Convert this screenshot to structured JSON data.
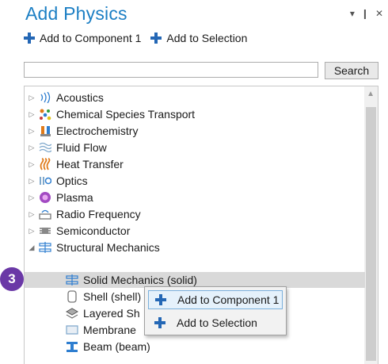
{
  "panel": {
    "title": "Add Physics",
    "controls": {
      "dropdown": "▾",
      "pin": "❙",
      "close": "✕"
    }
  },
  "toolbar": {
    "add_to_component": "Add to Component 1",
    "add_to_selection": "Add to Selection"
  },
  "search": {
    "value": "",
    "placeholder": "",
    "button_label": "Search"
  },
  "tree": {
    "items": [
      {
        "label": "Acoustics",
        "icon": "acoustics-icon",
        "expanded": false
      },
      {
        "label": "Chemical Species Transport",
        "icon": "chemical-species-icon",
        "expanded": false
      },
      {
        "label": "Electrochemistry",
        "icon": "electrochemistry-icon",
        "expanded": false
      },
      {
        "label": "Fluid Flow",
        "icon": "fluid-flow-icon",
        "expanded": false
      },
      {
        "label": "Heat Transfer",
        "icon": "heat-transfer-icon",
        "expanded": false
      },
      {
        "label": "Optics",
        "icon": "optics-icon",
        "expanded": false
      },
      {
        "label": "Plasma",
        "icon": "plasma-icon",
        "expanded": false
      },
      {
        "label": "Radio Frequency",
        "icon": "radio-frequency-icon",
        "expanded": false
      },
      {
        "label": "Semiconductor",
        "icon": "semiconductor-icon",
        "expanded": false
      },
      {
        "label": "Structural Mechanics",
        "icon": "structural-mechanics-icon",
        "expanded": true
      }
    ],
    "children": [
      {
        "label": "Solid Mechanics (solid)",
        "icon": "solid-mechanics-icon",
        "selected": true
      },
      {
        "label": "Shell (shell)",
        "icon": "shell-icon"
      },
      {
        "label": "Layered Sh",
        "icon": "layered-shell-icon"
      },
      {
        "label": "Membrane",
        "icon": "membrane-icon"
      },
      {
        "label": "Beam (beam)",
        "icon": "beam-icon"
      }
    ]
  },
  "context_menu": {
    "items": [
      {
        "label": "Add to Component 1",
        "icon": "plus-icon",
        "hover": true
      },
      {
        "label": "Add to Selection",
        "icon": "plus-icon"
      }
    ]
  },
  "step_badge": "3",
  "colors": {
    "title": "#1c7fc4",
    "plus": "#2467b5",
    "badge": "#6a38a6",
    "selection": "#d9d9d9",
    "menu_hover": "#e5f1fb"
  }
}
